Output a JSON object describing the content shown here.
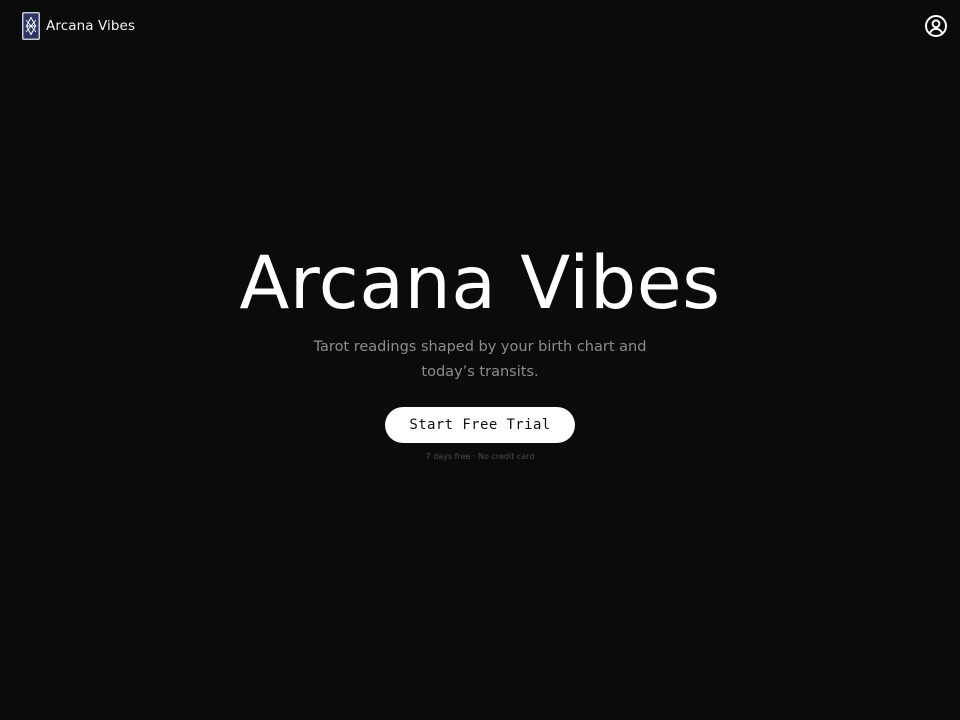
{
  "header": {
    "brand_name": "Arcana Vibes",
    "logo_icon": "tarot-card-icon",
    "account_icon": "user-circle-icon"
  },
  "hero": {
    "title": "Arcana Vibes",
    "tagline": "Tarot readings shaped by your birth chart and today’s transits.",
    "cta_label": "Start Free Trial",
    "cta_note": "7 days free · No credit card"
  },
  "colors": {
    "background": "#0b0b0c",
    "text": "#ffffff",
    "muted_text": "#8c8c8c",
    "faint_text": "#4d4d4d",
    "button_background": "#ffffff",
    "button_text": "#111111",
    "logo_card": "#2b3566"
  }
}
